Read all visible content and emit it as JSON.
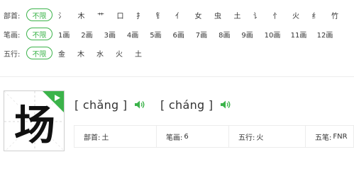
{
  "filters": {
    "bushou": {
      "label": "部首:",
      "all": "不限",
      "items": [
        "氵",
        "木",
        "艹",
        "口",
        "扌",
        "钅",
        "亻",
        "女",
        "虫",
        "土",
        "讠",
        "忄",
        "火",
        "纟",
        "竹"
      ]
    },
    "bihua": {
      "label": "笔画:",
      "all": "不限",
      "items": [
        "1画",
        "2画",
        "3画",
        "4画",
        "5画",
        "6画",
        "7画",
        "8画",
        "9画",
        "10画",
        "11画",
        "12画"
      ]
    },
    "wuxing": {
      "label": "五行:",
      "all": "不限",
      "items": [
        "金",
        "木",
        "水",
        "火",
        "土"
      ]
    }
  },
  "character": {
    "glyph": "场",
    "pinyin": [
      {
        "text": "[ chǎng ]"
      },
      {
        "text": "[ cháng ]"
      }
    ]
  },
  "info": {
    "bushou_key": "部首:",
    "bushou_val": "土",
    "bihua_key": "笔画:",
    "bihua_val": "6",
    "wuxing_key": "五行:",
    "wuxing_val": "火",
    "wubi_key": "五笔:",
    "wubi_val": "FNR"
  },
  "colors": {
    "accent": "#3bb34a",
    "border": "#ececec"
  }
}
